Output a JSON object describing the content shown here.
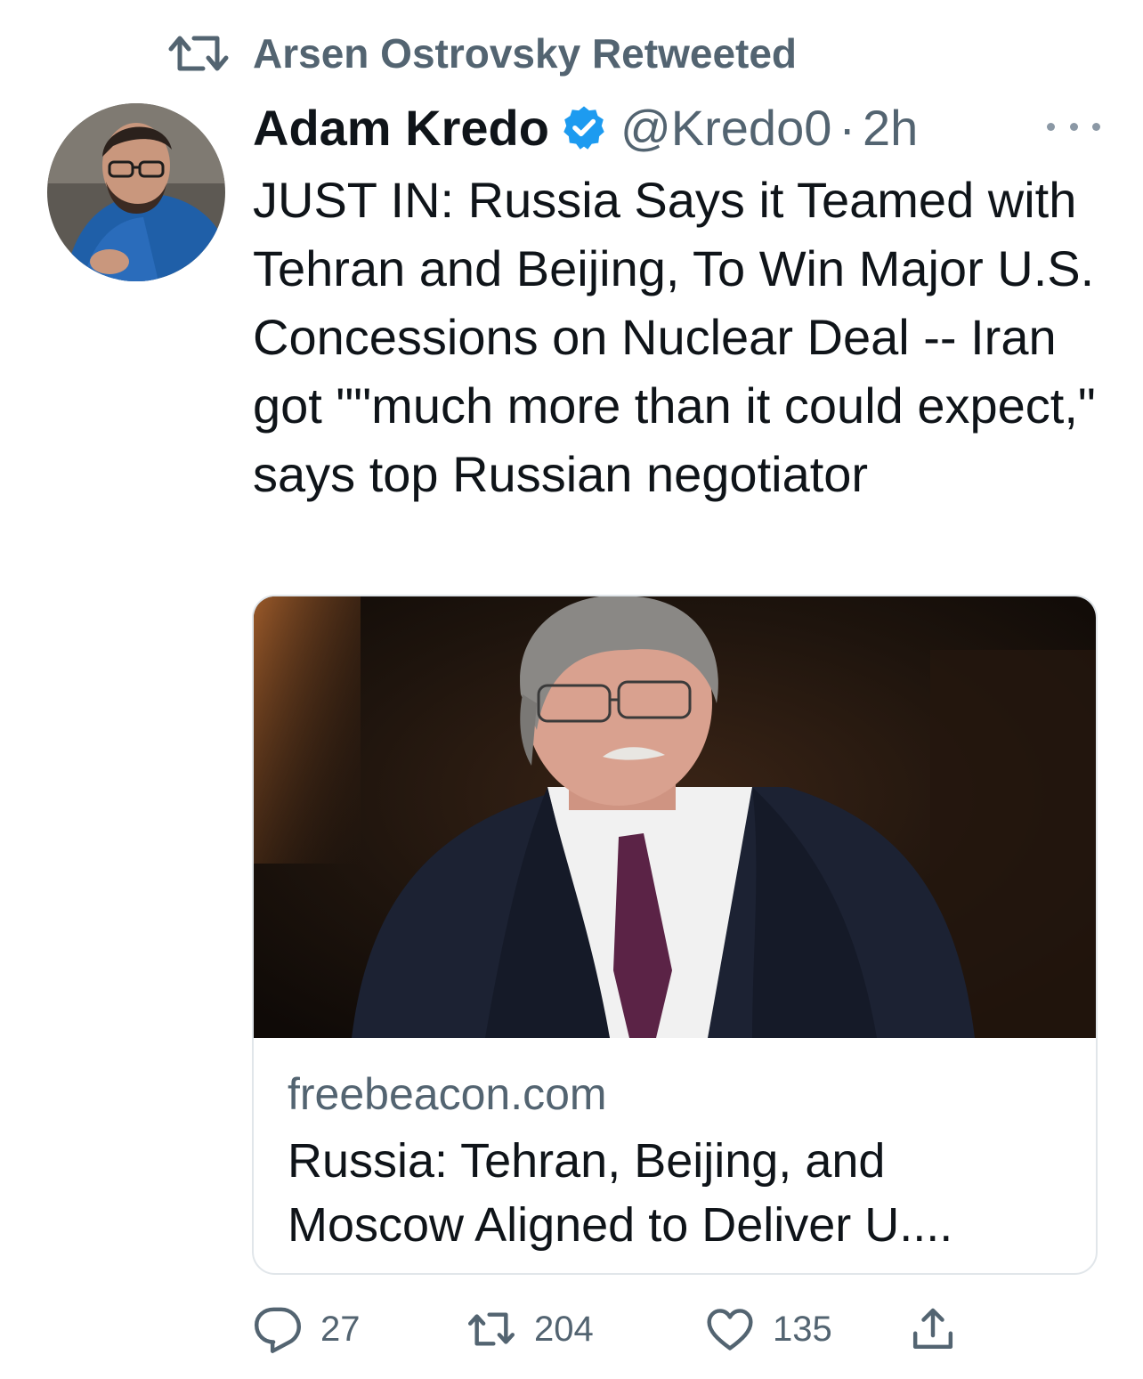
{
  "retweet_banner": {
    "text": "Arsen Ostrovsky Retweeted"
  },
  "author": {
    "name": "Adam Kredo",
    "handle": "@Kredo0",
    "separator": "·",
    "time": "2h"
  },
  "tweet": {
    "text": "JUST IN: Russia Says it Teamed with Tehran and Beijing, To Win Major U.S. Concessions on Nuclear Deal -- Iran got \"\"much more than it could expect,\" says top Russian negotiator"
  },
  "link_card": {
    "domain": "freebeacon.com",
    "title": "Russia: Tehran, Beijing, and Moscow Aligned to Deliver U...."
  },
  "actions": {
    "replies": "27",
    "retweets": "204",
    "likes": "135"
  },
  "colors": {
    "text": "#0f1419",
    "secondary": "#536471",
    "verified": "#1d9bf0",
    "border": "#e1e6ea"
  },
  "icons": [
    "retweet-icon",
    "verified-badge-icon",
    "more-icon",
    "reply-icon",
    "like-icon",
    "share-icon"
  ]
}
